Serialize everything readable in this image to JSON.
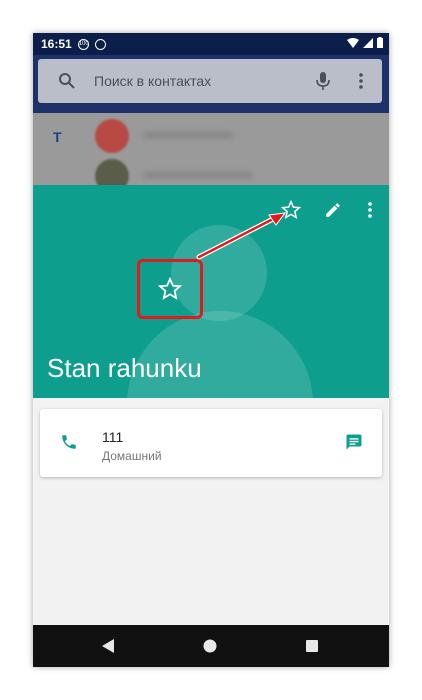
{
  "status_bar": {
    "time": "16:51",
    "badge": "100"
  },
  "search": {
    "placeholder": "Поиск в контактах"
  },
  "contacts_list": {
    "section_letter": "T"
  },
  "contact": {
    "name": "Stan rahunku"
  },
  "phone_entry": {
    "number": "111",
    "type": "Домашний"
  },
  "colors": {
    "accent": "#0e9e8e",
    "highlight": "#e11b1b",
    "status_bar": "#0b1f4a"
  },
  "icons": [
    "search-icon",
    "mic-icon",
    "more-vert-icon",
    "star-outline-icon",
    "pencil-icon",
    "phone-icon",
    "message-icon",
    "back-icon",
    "home-icon",
    "recents-icon"
  ]
}
